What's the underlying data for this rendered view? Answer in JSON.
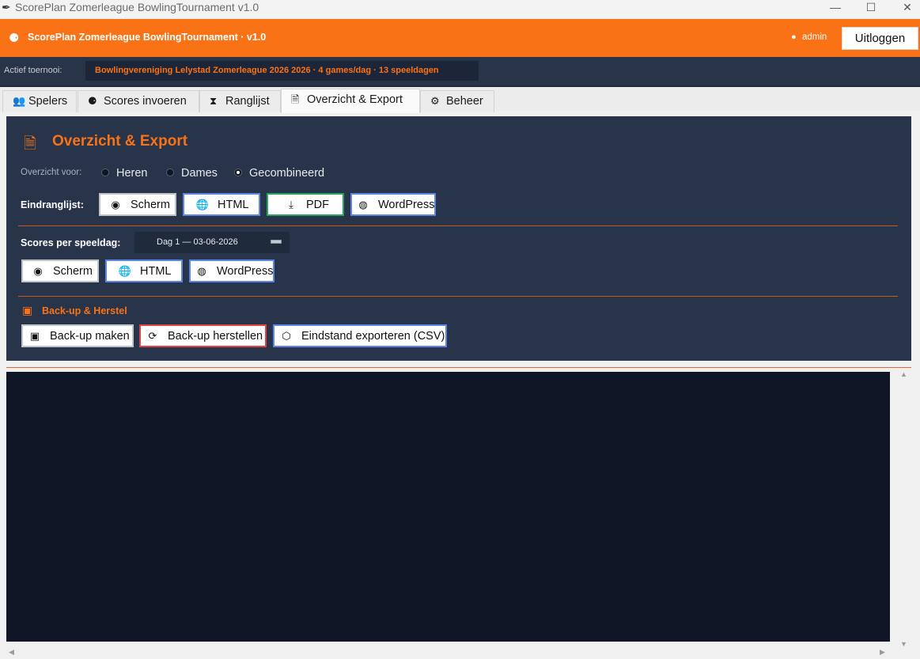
{
  "window": {
    "title": "ScorePlan Zomerleague BowlingTournament v1.0",
    "controls": {
      "minimize": "—",
      "maximize": "☐",
      "close": "✕"
    }
  },
  "header": {
    "brand": "ScorePlan Zomerleague BowlingTournament  ·  v1.0",
    "user": "admin",
    "logout_label": "Uitloggen",
    "accent_color": "#f97316"
  },
  "active_tournament": {
    "label": "Actief toernooi:",
    "value": "Bowlingvereniging Lelystad Zomerleague 2026 2026  ·  4 games/dag  ·  13 speeldagen"
  },
  "tabs": [
    {
      "label": "Spelers",
      "icon": "players-icon"
    },
    {
      "label": "Scores invoeren",
      "icon": "bowling-icon"
    },
    {
      "label": "Ranglijst",
      "icon": "trophy-icon"
    },
    {
      "label": "Overzicht & Export",
      "icon": "document-icon",
      "active": true
    },
    {
      "label": "Beheer",
      "icon": "gear-icon"
    }
  ],
  "panel": {
    "title": "Overzicht & Export",
    "overview_for": {
      "label": "Overzicht voor:",
      "options": [
        "Heren",
        "Dames",
        "Gecombineerd"
      ],
      "selected": "Gecombineerd"
    },
    "final_ranking": {
      "label": "Eindranglijst:",
      "buttons": [
        "Scherm",
        "HTML",
        "PDF",
        "WordPress"
      ]
    },
    "scores_per_day": {
      "label": "Scores per speeldag:",
      "selected_day": "Dag 1  —  03-06-2026",
      "buttons": [
        "Scherm",
        "HTML",
        "WordPress"
      ]
    },
    "backup": {
      "title": "Back-up & Herstel",
      "buttons": [
        "Back-up maken",
        "Back-up herstellen",
        "Eindstand exporteren (CSV)"
      ]
    }
  }
}
